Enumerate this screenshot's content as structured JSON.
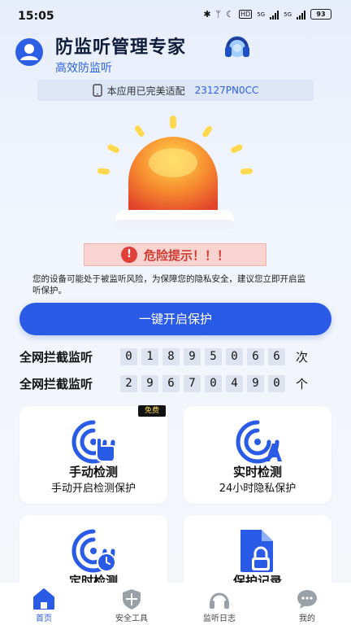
{
  "status_bar": {
    "time": "15:05",
    "network": "5G",
    "battery": "93"
  },
  "header": {
    "title": "防监听管理专家",
    "subtitle": "高效防监听"
  },
  "compat": {
    "text": "本应用已完美适配",
    "model": "23127PN0CC"
  },
  "warning": {
    "label": "危险提示！！！",
    "icon": "!"
  },
  "description": "您的设备可能处于被监听风险，为保障您的隐私安全，建议您立即开启监听保护。",
  "cta": {
    "label": "一键开启保护"
  },
  "counters": [
    {
      "label": "全网拦截监听",
      "digits": [
        "0",
        "1",
        "8",
        "9",
        "5",
        "0",
        "6",
        "6"
      ],
      "unit": "次"
    },
    {
      "label": "全网拦截监听",
      "digits": [
        "2",
        "9",
        "6",
        "7",
        "0",
        "4",
        "9",
        "0"
      ],
      "unit": "个"
    }
  ],
  "cards": [
    {
      "title": "手动检测",
      "subtitle": "手动开启检测保护",
      "badge": "免费",
      "icon": "hand-scan-icon"
    },
    {
      "title": "实时检测",
      "subtitle": "24小时隐私保护",
      "icon": "realtime-scan-icon"
    },
    {
      "title": "定时检测",
      "icon": "timer-scan-icon"
    },
    {
      "title": "保护记录",
      "icon": "record-file-icon"
    }
  ],
  "nav": [
    {
      "label": "首页",
      "icon": "home-icon",
      "active": true
    },
    {
      "label": "安全工具",
      "icon": "shield-icon"
    },
    {
      "label": "监听日志",
      "icon": "headset-icon"
    },
    {
      "label": "我的",
      "icon": "chat-bubble-icon"
    }
  ],
  "colors": {
    "primary": "#2a5be6",
    "danger": "#e0403a",
    "alarm_orange": "#f2782d",
    "alarm_yellow": "#ffd53a"
  }
}
